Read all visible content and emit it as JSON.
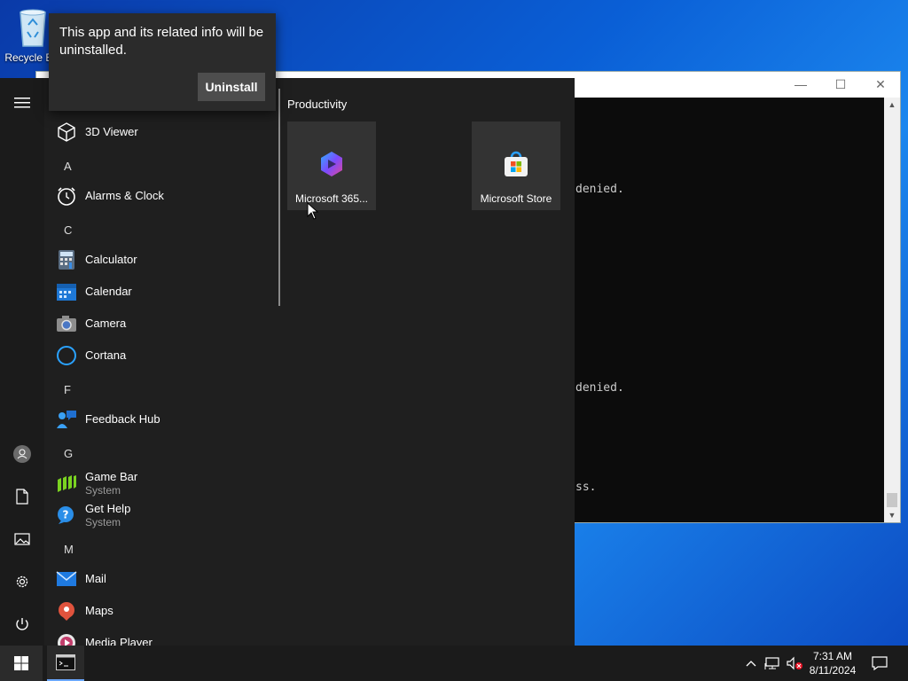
{
  "desktop": {
    "recycle_bin_label": "Recycle Bin"
  },
  "console": {
    "lines": [
      "denied.",
      "denied.",
      "ss."
    ],
    "minimize": "—",
    "maximize": "☐",
    "close": "✕"
  },
  "flyout": {
    "message": "This app and its related info will be uninstalled.",
    "button_label": "Uninstall"
  },
  "start_menu": {
    "apps": [
      {
        "label": "3D Viewer",
        "icon": "cube-icon"
      },
      {
        "letter": "A"
      },
      {
        "label": "Alarms & Clock",
        "icon": "alarm-clock-icon"
      },
      {
        "letter": "C"
      },
      {
        "label": "Calculator",
        "icon": "calculator-icon"
      },
      {
        "label": "Calendar",
        "icon": "calendar-icon"
      },
      {
        "label": "Camera",
        "icon": "camera-icon"
      },
      {
        "label": "Cortana",
        "icon": "cortana-icon"
      },
      {
        "letter": "F"
      },
      {
        "label": "Feedback Hub",
        "icon": "feedback-hub-icon"
      },
      {
        "letter": "G"
      },
      {
        "label": "Game Bar",
        "sub": "System",
        "icon": "game-bar-icon"
      },
      {
        "label": "Get Help",
        "sub": "System",
        "icon": "get-help-icon"
      },
      {
        "letter": "M"
      },
      {
        "label": "Mail",
        "icon": "mail-icon"
      },
      {
        "label": "Maps",
        "icon": "maps-icon"
      },
      {
        "label": "Media Player",
        "icon": "media-player-icon"
      }
    ],
    "group_title": "Productivity",
    "tiles": [
      {
        "label": "Microsoft 365...",
        "icon": "microsoft-365-icon"
      },
      {
        "label": "Microsoft Store",
        "icon": "microsoft-store-icon"
      }
    ],
    "rail_icons": [
      "hamburger-menu-icon",
      "user-icon",
      "documents-icon",
      "pictures-icon",
      "settings-icon",
      "power-icon"
    ]
  },
  "taskbar": {
    "time": "7:31 AM",
    "date": "8/11/2024",
    "tray_icons": [
      "show-hidden-icons-chevron-icon",
      "network-icon",
      "volume-muted-icon",
      "notifications-icon"
    ]
  },
  "colors": {
    "accent": "#0a5fd6",
    "menu_bg": "#1f1f1f",
    "tile_bg": "#333333"
  }
}
